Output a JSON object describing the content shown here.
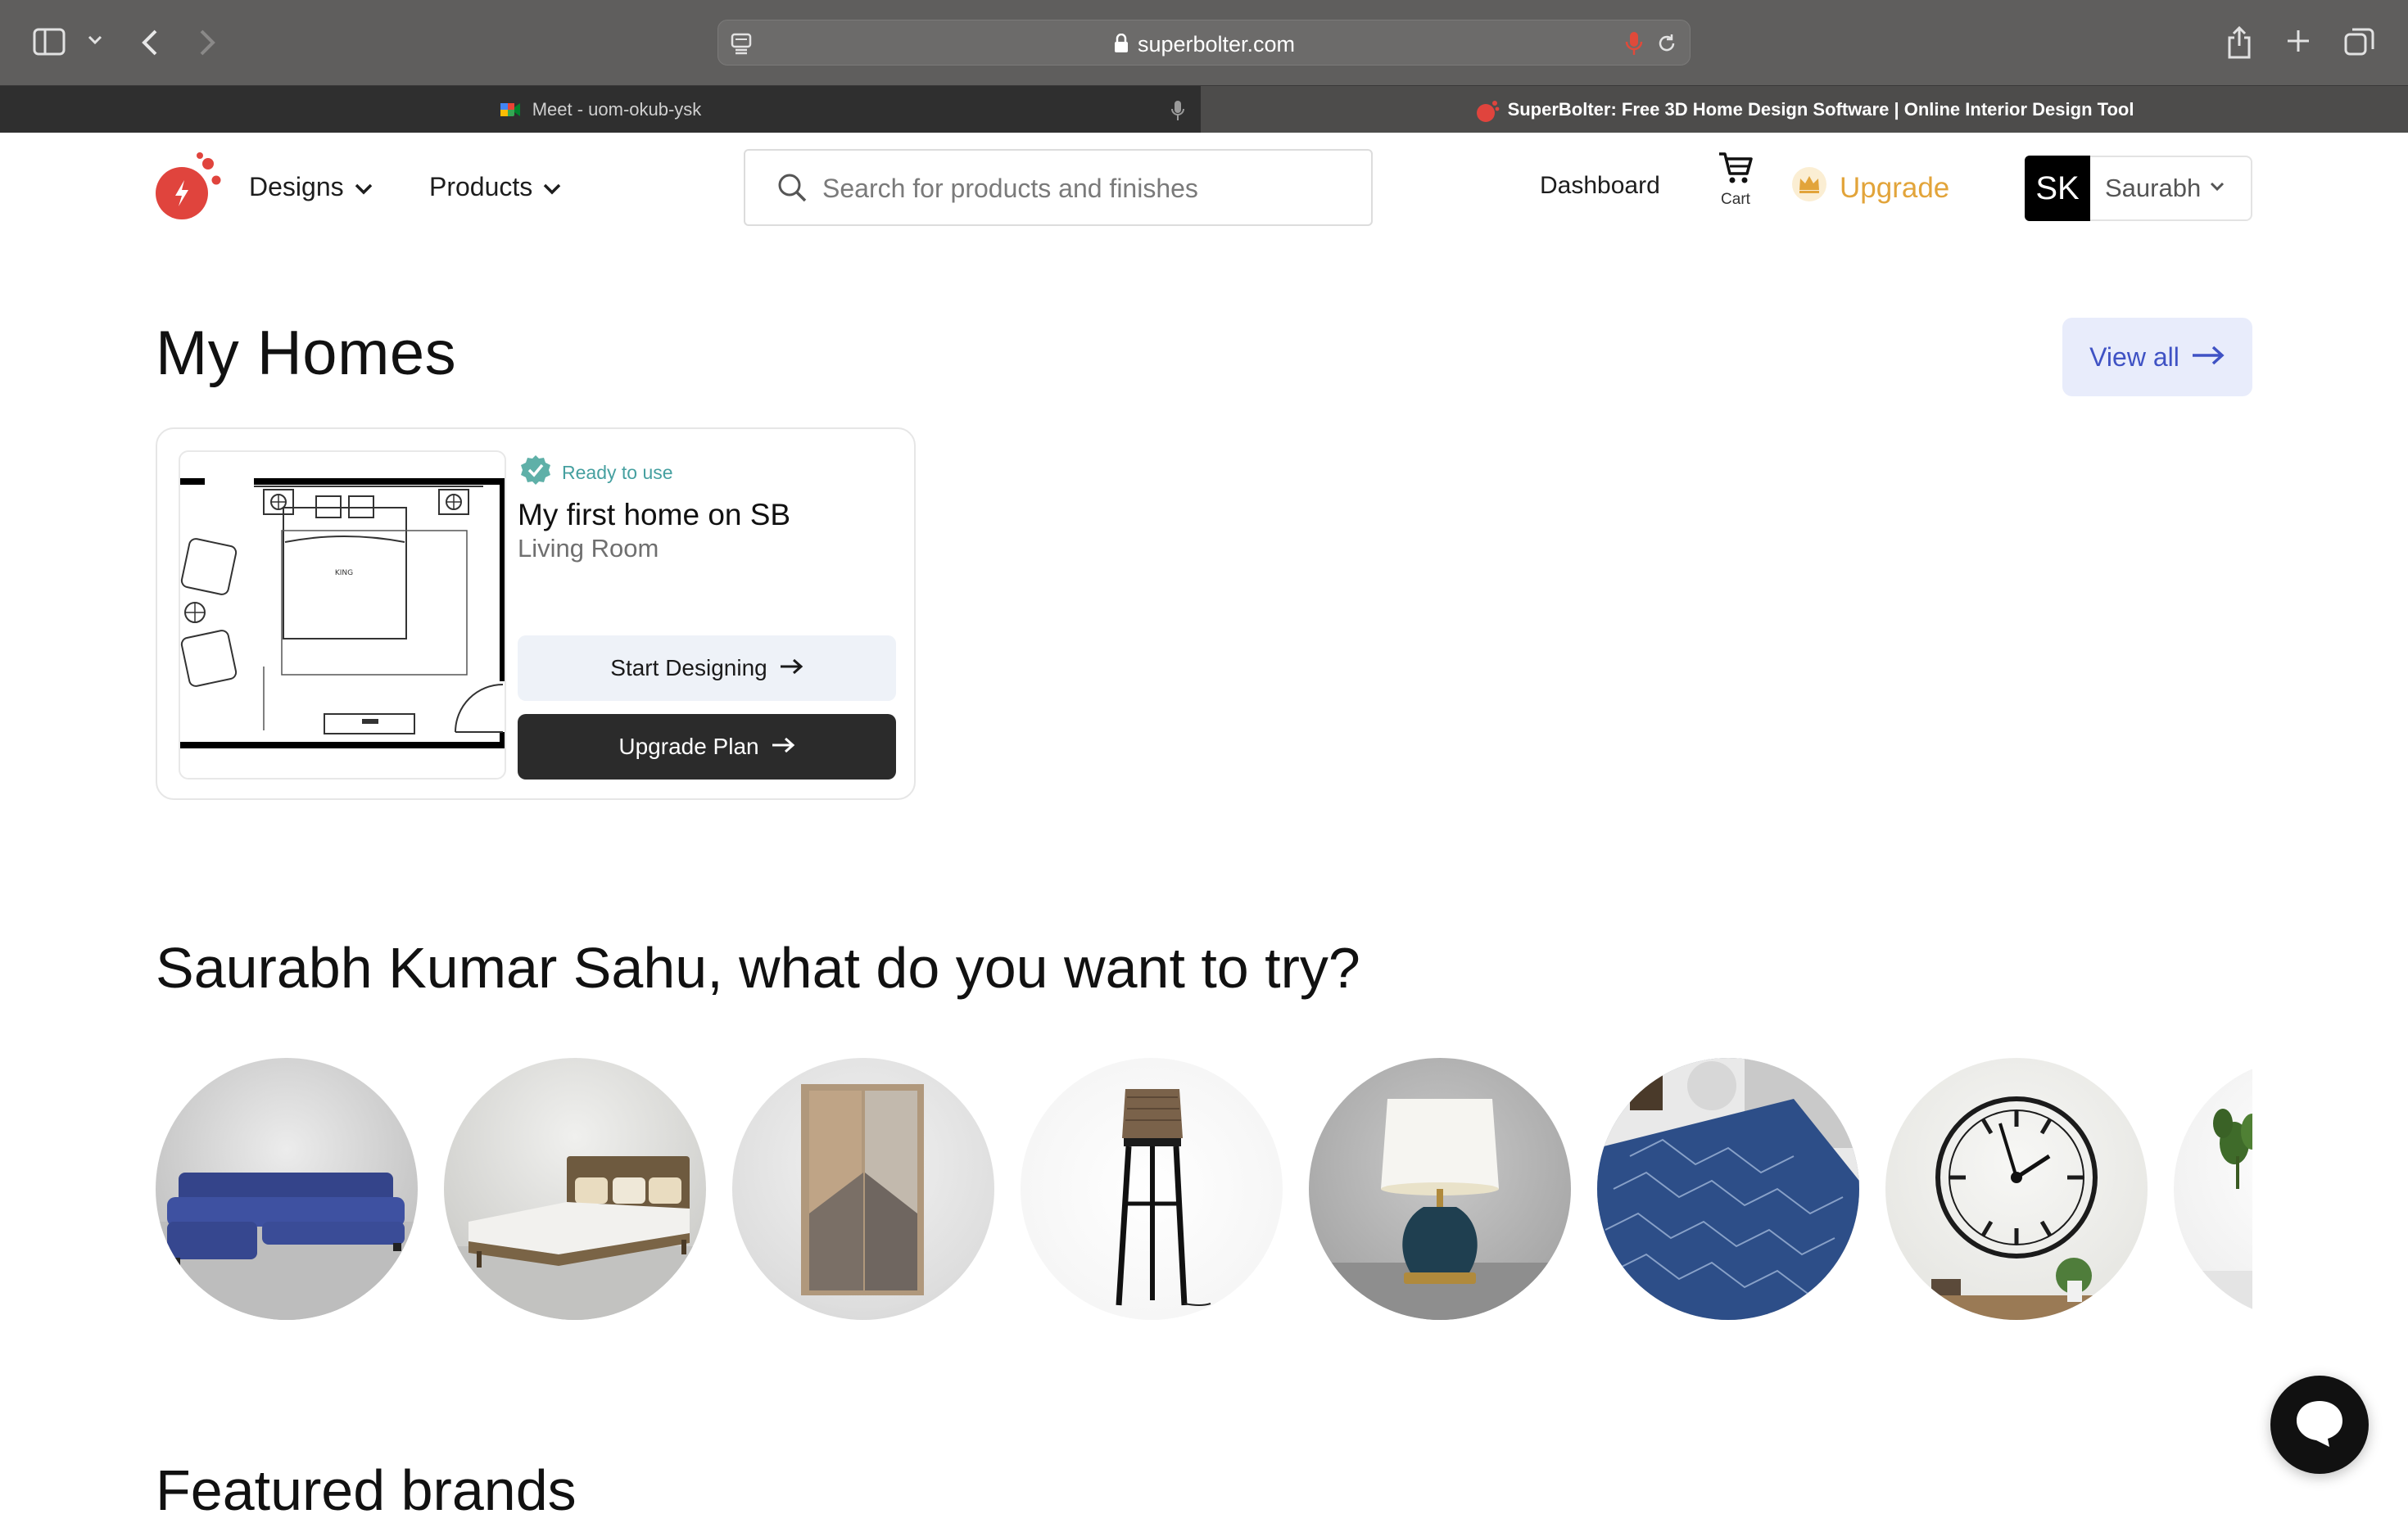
{
  "browser": {
    "url": "superbolter.com",
    "tabs": [
      {
        "title": "Meet - uom-okub-ysk"
      },
      {
        "title": "SuperBolter: Free 3D Home Design Software | Online Interior Design Tool"
      }
    ]
  },
  "header": {
    "nav": [
      {
        "label": "Designs"
      },
      {
        "label": "Products"
      }
    ],
    "search_placeholder": "Search for products and finishes",
    "dashboard_label": "Dashboard",
    "cart_label": "Cart",
    "upgrade_label": "Upgrade",
    "user": {
      "initials": "SK",
      "name": "Saurabh"
    }
  },
  "my_homes": {
    "title": "My Homes",
    "view_all_label": "View all",
    "card": {
      "status": "Ready to use",
      "name": "My first home on SB",
      "room": "Living Room",
      "start_label": "Start Designing",
      "upgrade_label": "Upgrade Plan",
      "floorplan_bed_label": "KING"
    }
  },
  "try_section": {
    "title": "Saurabh Kumar Sahu, what do you want to try?",
    "products": [
      {
        "icon": "sofa-icon"
      },
      {
        "icon": "bed-icon"
      },
      {
        "icon": "wardrobe-icon"
      },
      {
        "icon": "floor-lamp-icon"
      },
      {
        "icon": "table-lamp-icon"
      },
      {
        "icon": "rug-icon"
      },
      {
        "icon": "wall-clock-icon"
      },
      {
        "icon": "plant-icon"
      }
    ]
  },
  "featured": {
    "title": "Featured brands"
  },
  "colors": {
    "accent_red": "#e0443d",
    "upgrade_gold": "#e2a43a",
    "view_all_blue": "#3f52c4",
    "ready_teal": "#46a0a0"
  }
}
